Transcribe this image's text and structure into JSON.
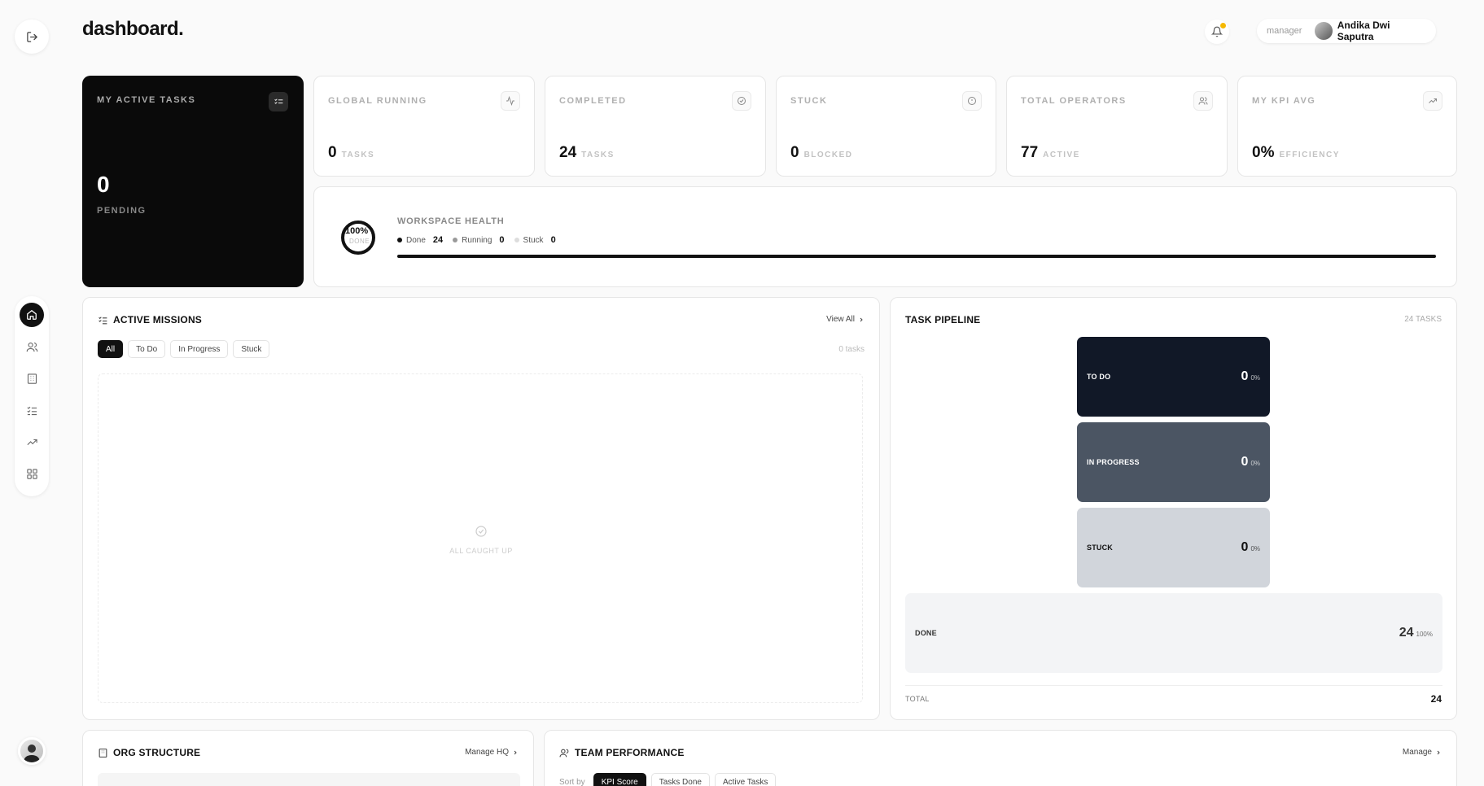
{
  "header": {
    "title": "dashboard.",
    "role": "manager",
    "user_name": "Andika Dwi Saputra",
    "notification_dot_color": "#f5b800"
  },
  "sidebar": {
    "items": [
      {
        "icon": "home-icon",
        "active": true
      },
      {
        "icon": "users-icon",
        "active": false
      },
      {
        "icon": "building-icon",
        "active": false
      },
      {
        "icon": "tasks-icon",
        "active": false
      },
      {
        "icon": "trending-icon",
        "active": false
      },
      {
        "icon": "grid-icon",
        "active": false
      }
    ]
  },
  "my_active_tasks": {
    "label": "MY ACTIVE TASKS",
    "value": "0",
    "sub": "PENDING"
  },
  "stats": [
    {
      "label": "GLOBAL RUNNING",
      "value": "0",
      "unit": "TASKS",
      "icon": "activity-icon"
    },
    {
      "label": "COMPLETED",
      "value": "24",
      "unit": "TASKS",
      "icon": "check-circle-icon"
    },
    {
      "label": "STUCK",
      "value": "0",
      "unit": "BLOCKED",
      "icon": "alert-circle-icon"
    },
    {
      "label": "TOTAL OPERATORS",
      "value": "77",
      "unit": "ACTIVE",
      "icon": "users-icon"
    },
    {
      "label": "MY KPI AVG",
      "value": "0%",
      "unit": "EFFICIENCY",
      "icon": "trending-up-icon"
    }
  ],
  "health": {
    "percent": "100%",
    "percent_sub": "DONE",
    "title": "WORKSPACE HEALTH",
    "done_label": "Done",
    "done_value": "24",
    "running_label": "Running",
    "running_value": "0",
    "stuck_label": "Stuck",
    "stuck_value": "0",
    "progress_fraction": 1.0
  },
  "missions": {
    "title": "ACTIVE MISSIONS",
    "view_all": "View All",
    "filters": [
      "All",
      "To Do",
      "In Progress",
      "Stuck"
    ],
    "active_filter": "All",
    "count": "0 tasks",
    "empty_text": "ALL CAUGHT UP"
  },
  "pipeline": {
    "title": "TASK PIPELINE",
    "count": "24 TASKS",
    "stages": [
      {
        "label": "TO DO",
        "value": "0",
        "pct": "0%",
        "bg": "#111827",
        "fg": "#ffffff"
      },
      {
        "label": "IN PROGRESS",
        "value": "0",
        "pct": "0%",
        "bg": "#4b5563",
        "fg": "#ffffff"
      },
      {
        "label": "STUCK",
        "value": "0",
        "pct": "0%",
        "bg": "#d1d5db",
        "fg": "#111111"
      },
      {
        "label": "DONE",
        "value": "24",
        "pct": "100%",
        "bg": "#f3f4f6",
        "fg": "#333333"
      }
    ],
    "total_label": "TOTAL",
    "total_value": "24"
  },
  "org": {
    "title": "ORG STRUCTURE",
    "manage": "Manage HQ"
  },
  "team": {
    "title": "TEAM PERFORMANCE",
    "manage": "Manage",
    "sort_label": "Sort by",
    "sort_options": [
      "KPI Score",
      "Tasks Done",
      "Active Tasks"
    ],
    "active_sort": "KPI Score"
  }
}
